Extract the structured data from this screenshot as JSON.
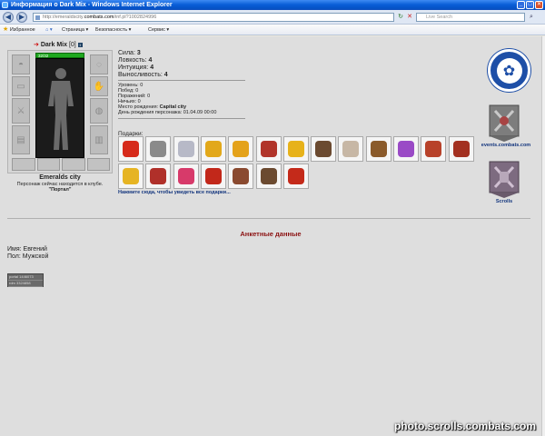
{
  "window": {
    "title": "Информация о Dark Mix - Windows Internet Explorer",
    "min": "_",
    "max": "□",
    "close": "✕"
  },
  "addressbar": {
    "back": "◀",
    "forward": "▶",
    "url_prefix": "http://emeraldscity.",
    "url_domain": "combats.com",
    "url_suffix": "/inf.pl?1002824996",
    "refresh": "↻",
    "stop": "✕",
    "search_placeholder": "Live Search",
    "search_go": "⌕"
  },
  "toolbar": {
    "favorites": "Избранное",
    "page": "Страница",
    "security": "Безопасность",
    "service": "Сервис"
  },
  "character": {
    "name": "Dark Mix",
    "level": "[0]",
    "info_icon": "i",
    "hp": "32/32",
    "hp_fraction": 1.0,
    "city": "Emeralds city",
    "club_text": "Персонаж сейчас находится в клубе.",
    "location": "\"Портал\""
  },
  "stats": [
    {
      "label": "Сила:",
      "value": "3"
    },
    {
      "label": "Ловкость:",
      "value": "4"
    },
    {
      "label": "Интуиция:",
      "value": "4"
    },
    {
      "label": "Выносливость:",
      "value": "4"
    }
  ],
  "info": {
    "level": "Уровень: 0",
    "wins": "Побед: 0",
    "losses": "Поражений: 0",
    "draws": "Ничьих: 0",
    "birthplace_label": "Место рождения:",
    "birthplace": "Capital city",
    "birthday": "День рождения персонажа: 01.04.09 00:00"
  },
  "gifts": {
    "label": "Подарки:",
    "link": "Нажмите сюда, чтобы увидеть все подарки...",
    "row1_colors": [
      "#d62a1a",
      "#8a8a8a",
      "#b7b9c7",
      "#e2a81a",
      "#e4a21a",
      "#b1342a",
      "#e7b21a",
      "#6b4a30",
      "#c7b7a5",
      "#8a5a2a",
      "#9a4ac6",
      "#b8422a",
      "#a33020"
    ],
    "row2_colors": [
      "#e6b423",
      "#b0302a",
      "#d73a6a",
      "#c2281a",
      "#8a4a30",
      "#6b4a30",
      "#c42a1a"
    ]
  },
  "right": {
    "emblem_glyph": "✿",
    "events_label": "events.combats.com",
    "scrolls_label": "Scrolls"
  },
  "profile": {
    "section_title": "Анкетные данные",
    "name": "Имя: Евгений",
    "sex": "Пол: Мужской",
    "counter1": "portal 1446073",
    "counter2": "rdm 3324858"
  },
  "watermark": "photo.scrolls.combats.com"
}
